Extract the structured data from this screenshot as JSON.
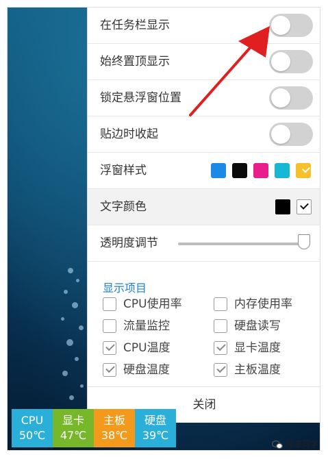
{
  "settings": {
    "toggles": [
      {
        "label": "在任务栏显示",
        "on": false
      },
      {
        "label": "始终置顶显示",
        "on": false
      },
      {
        "label": "锁定悬浮窗位置",
        "on": false
      },
      {
        "label": "贴边时收起",
        "on": false
      }
    ],
    "float_style": {
      "label": "浮窗样式",
      "swatches": [
        {
          "color": "#1e88e5",
          "selected": false
        },
        {
          "color": "#0a0a0a",
          "selected": false
        },
        {
          "color": "#e91e8c",
          "selected": false
        },
        {
          "color": "#18b8d4",
          "selected": false
        },
        {
          "color": "#f6c02a",
          "selected": true
        }
      ]
    },
    "text_color": {
      "label": "文字颜色",
      "options": [
        {
          "color": "#000000",
          "selected": false
        },
        {
          "color": "#ffffff",
          "selected": true
        }
      ]
    },
    "opacity": {
      "label": "透明度调节",
      "value_percent": 100
    }
  },
  "display_items": {
    "title": "显示项目",
    "items": [
      {
        "label": "CPU使用率",
        "checked": false
      },
      {
        "label": "内存使用率",
        "checked": false
      },
      {
        "label": "流量监控",
        "checked": false
      },
      {
        "label": "硬盘读写",
        "checked": false
      },
      {
        "label": "CPU温度",
        "checked": true
      },
      {
        "label": "显卡温度",
        "checked": true
      },
      {
        "label": "硬盘温度",
        "checked": true
      },
      {
        "label": "主板温度",
        "checked": true
      }
    ]
  },
  "close_label": "关闭",
  "float_widget": {
    "cells": [
      {
        "name": "CPU",
        "value": "50℃",
        "color": "#2ab0d8"
      },
      {
        "name": "显卡",
        "value": "47℃",
        "color": "#76b82a"
      },
      {
        "name": "主板",
        "value": "38℃",
        "color": "#f39a1d"
      },
      {
        "name": "硬盘",
        "value": "39℃",
        "color": "#2ab0d8"
      }
    ]
  },
  "watermark": "阿虚同学",
  "colors": {
    "accent": "#1e7fd0",
    "arrow": "#e02020"
  }
}
